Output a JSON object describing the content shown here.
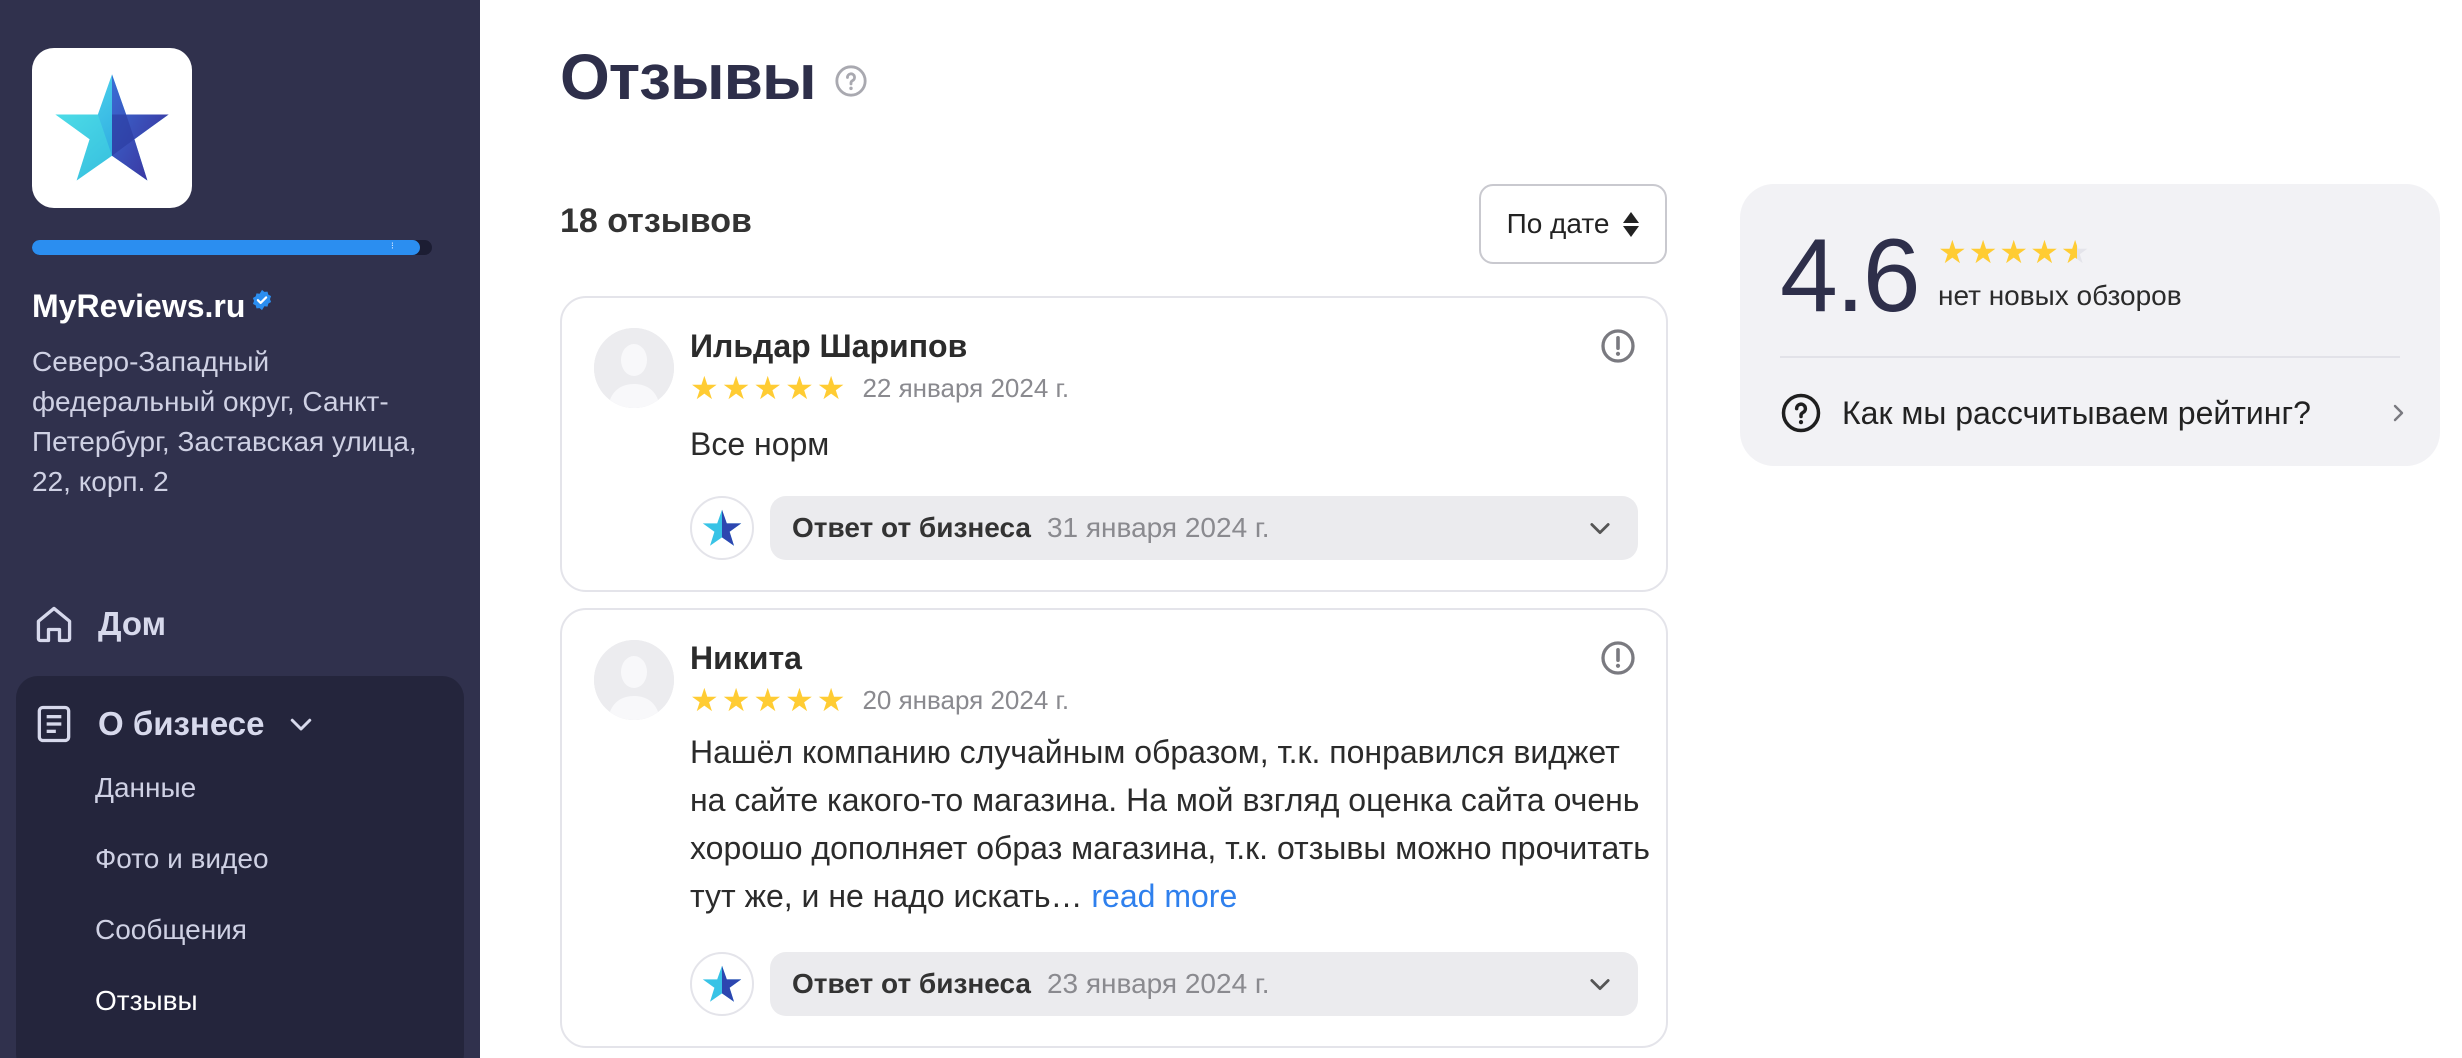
{
  "sidebar": {
    "company_name": "MyReviews.ru",
    "address": "Северо-Западный федеральный округ, Санкт-Петербург, Заставская улица, 22, корп. 2",
    "profile_progress": 0.97,
    "nav": {
      "home": "Дом",
      "about": "О бизнесе",
      "sub_items": [
        "Данные",
        "Фото и видео",
        "Сообщения",
        "Отзывы"
      ]
    }
  },
  "main": {
    "title": "Отзывы",
    "count_label": "18 отзывов",
    "sort_label": "По дате",
    "reviews": [
      {
        "author": "Ильдар Шарипов",
        "rating": 5,
        "date": "22 января 2024 г.",
        "text": "Все норм",
        "reply_label": "Ответ от бизнеса",
        "reply_date": "31 января 2024 г."
      },
      {
        "author": "Никита",
        "rating": 5,
        "date": "20 января 2024 г.",
        "text": "Нашёл компанию случайным образом, т.к. понравился виджет на сайте какого-то магазина. На мой взгляд оценка сайта очень хорошо дополняет образ магазина, т.к. отзывы можно прочитать тут же, и не надо искать…",
        "read_more": "read more",
        "reply_label": "Ответ от бизнеса",
        "reply_date": "23 января 2024 г."
      }
    ]
  },
  "rating_panel": {
    "value": "4.6",
    "stars_value": 4.6,
    "note": "нет новых обзоров",
    "help_link": "Как мы рассчитываем рейтинг?"
  },
  "colors": {
    "sidebar_bg": "#30314d",
    "accent_blue": "#2b8ef0",
    "star_yellow": "#ffcc33",
    "link_blue": "#2f80ed"
  },
  "icons": [
    "star-logo-icon",
    "verified-badge-icon",
    "home-icon",
    "document-icon",
    "chevron-down-icon",
    "help-icon",
    "sort-arrows-icon",
    "flag-icon",
    "chevron-right-icon"
  ]
}
